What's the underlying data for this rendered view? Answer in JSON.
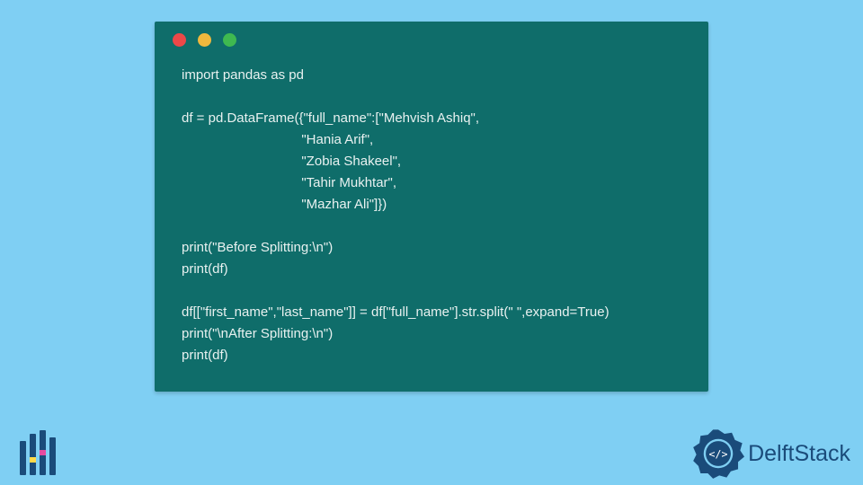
{
  "code": {
    "lines": "import pandas as pd\n\ndf = pd.DataFrame({\"full_name\":[\"Mehvish Ashiq\",\n                                \"Hania Arif\",\n                                \"Zobia Shakeel\",\n                                \"Tahir Mukhtar\",\n                                \"Mazhar Ali\"]})\n\nprint(\"Before Splitting:\\n\")\nprint(df)\n\ndf[[\"first_name\",\"last_name\"]] = df[\"full_name\"].str.split(\" \",expand=True)\nprint(\"\\nAfter Splitting:\\n\")\nprint(df)"
  },
  "brand_right": "DelftStack",
  "colors": {
    "background": "#7fcff3",
    "window": "#0f6d6a",
    "text": "#e8f1f0",
    "brand_primary": "#1a4b7a"
  }
}
